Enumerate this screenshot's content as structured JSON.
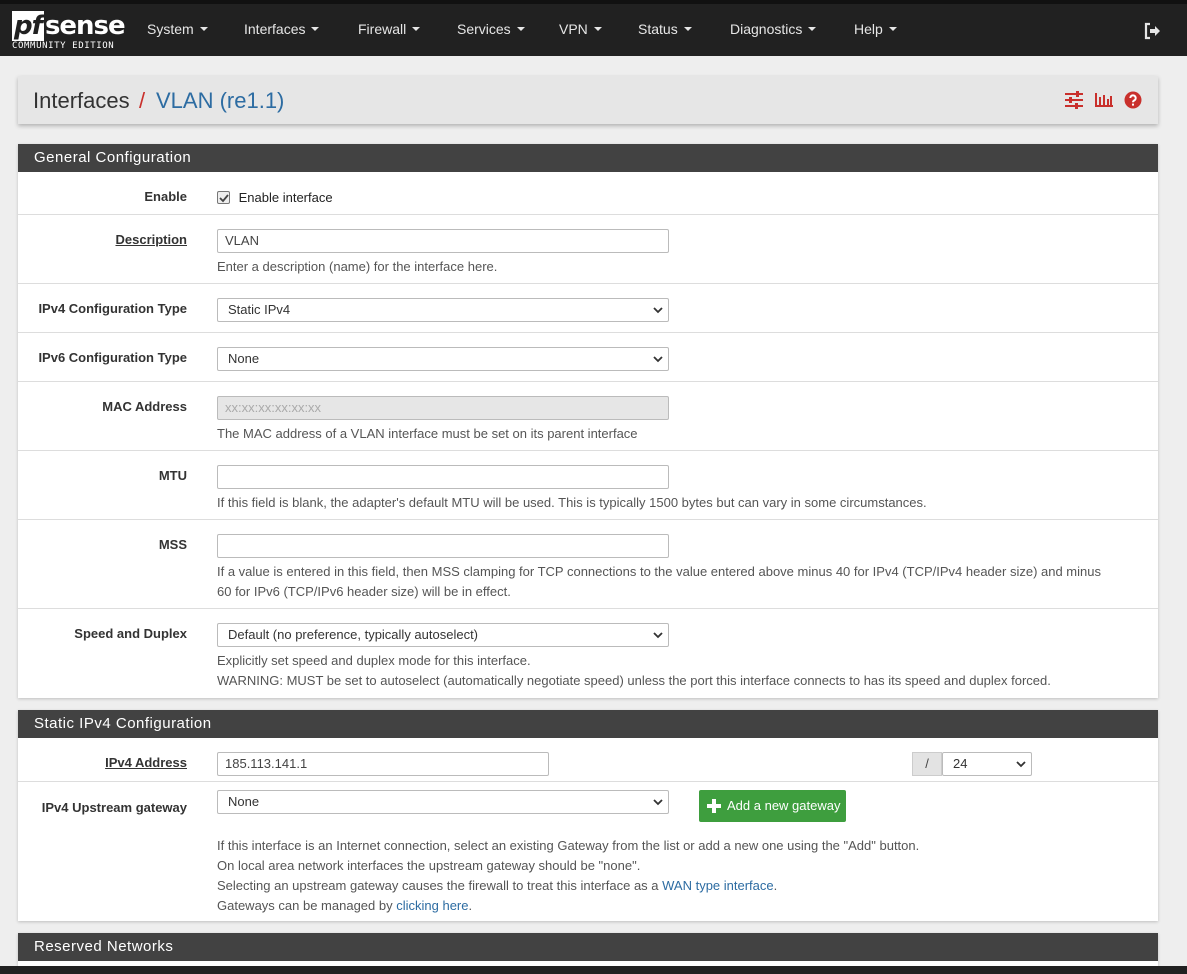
{
  "brand": {
    "name": "pfsense",
    "pf": "pf",
    "sense": "sense",
    "edition": "COMMUNITY EDITION"
  },
  "nav": {
    "items": [
      {
        "label": "System"
      },
      {
        "label": "Interfaces"
      },
      {
        "label": "Firewall"
      },
      {
        "label": "Services"
      },
      {
        "label": "VPN"
      },
      {
        "label": "Status"
      },
      {
        "label": "Diagnostics"
      },
      {
        "label": "Help"
      }
    ]
  },
  "breadcrumb": {
    "section": "Interfaces",
    "separator": "/",
    "page": "VLAN (re1.1)"
  },
  "general": {
    "title": "General Configuration",
    "enable": {
      "label": "Enable",
      "checkbox_label": "Enable interface",
      "checked": true
    },
    "description": {
      "label": "Description",
      "value": "VLAN",
      "help": "Enter a description (name) for the interface here."
    },
    "ipv4_type": {
      "label": "IPv4 Configuration Type",
      "value": "Static IPv4"
    },
    "ipv6_type": {
      "label": "IPv6 Configuration Type",
      "value": "None"
    },
    "mac": {
      "label": "MAC Address",
      "placeholder": "xx:xx:xx:xx:xx:xx",
      "help": "The MAC address of a VLAN interface must be set on its parent interface"
    },
    "mtu": {
      "label": "MTU",
      "value": "",
      "help": "If this field is blank, the adapter's default MTU will be used. This is typically 1500 bytes but can vary in some circumstances."
    },
    "mss": {
      "label": "MSS",
      "value": "",
      "help_line1": "If a value is entered in this field, then MSS clamping for TCP connections to the value entered above minus 40 for IPv4 (TCP/IPv4 header size) and minus",
      "help_line2": "60 for IPv6 (TCP/IPv6 header size) will be in effect."
    },
    "speed": {
      "label": "Speed and Duplex",
      "value": "Default (no preference, typically autoselect)",
      "help_line1": "Explicitly set speed and duplex mode for this interface.",
      "help_line2": "WARNING: MUST be set to autoselect (automatically negotiate speed) unless the port this interface connects to has its speed and duplex forced."
    }
  },
  "static_ipv4": {
    "title": "Static IPv4 Configuration",
    "address": {
      "label": "IPv4 Address",
      "value": "185.113.141.1",
      "slash": "/",
      "cidr": "24"
    },
    "gateway": {
      "label": "IPv4 Upstream gateway",
      "value": "None",
      "add_button": "Add a new gateway",
      "help_line1": "If this interface is an Internet connection, select an existing Gateway from the list or add a new one using the \"Add\" button.",
      "help_line2": "On local area network interfaces the upstream gateway should be \"none\".",
      "help_line3_pre": "Selecting an upstream gateway causes the firewall to treat this interface as a ",
      "help_line3_link": "WAN type interface",
      "help_line3_post": ".",
      "help_line4_pre": "Gateways can be managed by ",
      "help_line4_link": "clicking here",
      "help_line4_post": "."
    }
  },
  "reserved": {
    "title": "Reserved Networks"
  },
  "colors": {
    "nav_bg": "#212121",
    "panel_header": "#424242",
    "link": "#2d6ca2",
    "accent_red": "#c9302c",
    "button_green": "#3e9e3e"
  }
}
